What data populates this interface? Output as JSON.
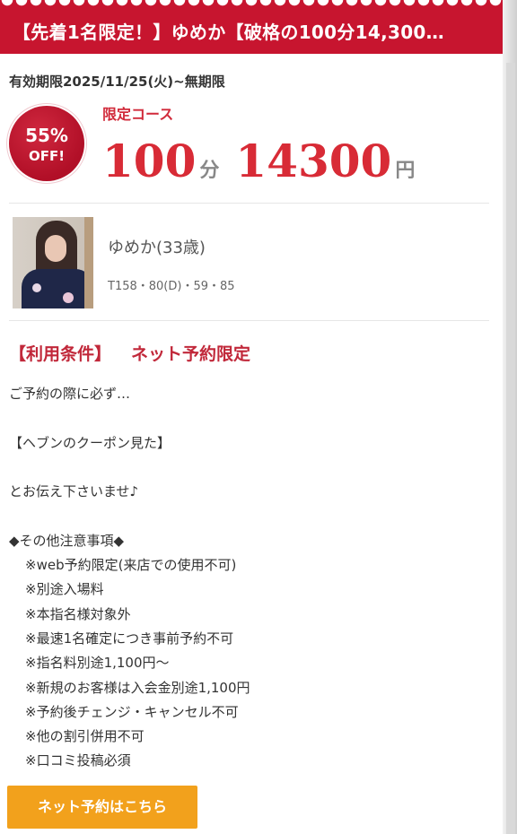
{
  "coupon": {
    "title": "【先着1名限定！】ゆめか【破格の100分14,300…",
    "validity": "有効期限2025/11/25(火)~無期限",
    "badge": {
      "percent": "55%",
      "off": "OFF!"
    },
    "course_label": "限定コース",
    "duration": {
      "value": "100",
      "unit": "分"
    },
    "price": {
      "value": "14300",
      "unit": "円"
    }
  },
  "profile": {
    "name": "ゆめか(33歳)",
    "sizes": "T158・80(D)・59・85"
  },
  "conditions": {
    "title_left": "【利用条件】",
    "title_right": "ネット予約限定",
    "lines": [
      {
        "text": "ご予約の際に必ず…",
        "indent": false
      },
      {
        "text": "",
        "indent": false
      },
      {
        "text": "【ヘブンのクーポン見た】",
        "indent": false
      },
      {
        "text": "",
        "indent": false
      },
      {
        "text": "とお伝え下さいませ♪",
        "indent": false
      },
      {
        "text": "",
        "indent": false
      },
      {
        "text": "◆その他注意事項◆",
        "indent": false
      },
      {
        "text": "※web予約限定(来店での使用不可)",
        "indent": true
      },
      {
        "text": "※別途入場料",
        "indent": true
      },
      {
        "text": "※本指名様対象外",
        "indent": true
      },
      {
        "text": "※最速1名確定につき事前予約不可",
        "indent": true
      },
      {
        "text": "※指名料別途1,100円〜",
        "indent": true
      },
      {
        "text": "※新規のお客様は入会金別途1,100円",
        "indent": true
      },
      {
        "text": "※予約後チェンジ・キャンセル不可",
        "indent": true
      },
      {
        "text": "※他の割引併用不可",
        "indent": true
      },
      {
        "text": "※口コミ投稿必須",
        "indent": true
      }
    ]
  },
  "cta": {
    "label": "ネット予約はこちら"
  },
  "colors": {
    "brand_red": "#c7152f",
    "price_red": "#d82b36",
    "button_orange": "#f2a11c"
  }
}
